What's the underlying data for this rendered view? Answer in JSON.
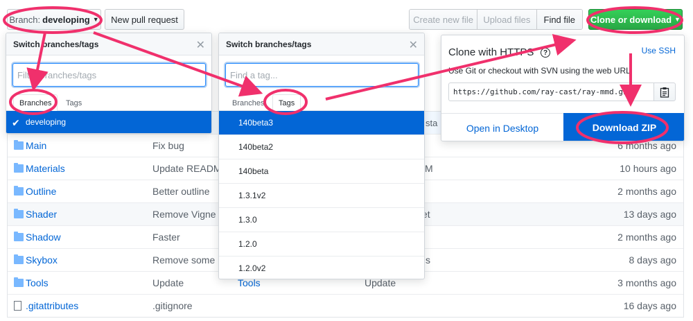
{
  "toolbar": {
    "branch_label": "Branch:",
    "branch_name": "developing",
    "new_pull_request": "New pull request",
    "create_new_file": "Create new file",
    "upload_files": "Upload files",
    "find_file": "Find file",
    "clone_or_download": "Clone or download"
  },
  "files": [
    {
      "name": "Main",
      "message": "Fix bug",
      "age": "6 months ago",
      "type": "folder"
    },
    {
      "name": "Materials",
      "message": "Update READM",
      "age": "10 hours ago",
      "type": "folder"
    },
    {
      "name": "Outline",
      "message": "Better outline",
      "age": "2 months ago",
      "type": "folder"
    },
    {
      "name": "Shader",
      "message": "Remove Vigne",
      "age": "13 days ago",
      "type": "folder"
    },
    {
      "name": "Shadow",
      "message": "Faster",
      "age": "2 months ago",
      "type": "folder"
    },
    {
      "name": "Skybox",
      "message": "Remove some",
      "age": "8 days ago",
      "type": "folder"
    },
    {
      "name": "Tools",
      "message": "Update",
      "age": "3 months ago",
      "type": "folder"
    },
    {
      "name": ".gitattributes",
      "message": ".gitignore",
      "age": "16 days ago",
      "type": "file"
    }
  ],
  "background_fragments": {
    "row_main_msg": "Fix bug",
    "materials_tail": "M",
    "shader_tail": "et",
    "skybox_tail": "s",
    "tools_name": "Tools",
    "tools_msg": "Update",
    "above_row_tail": "sta",
    "main_age": "6 months ago"
  },
  "branch_menu": {
    "title": "Switch branches/tags",
    "filter_placeholder": "Filter branches/tags",
    "tabs": [
      "Branches",
      "Tags"
    ],
    "items": [
      "developing"
    ]
  },
  "tag_menu": {
    "title": "Switch branches/tags",
    "filter_placeholder": "Find a tag...",
    "tabs": [
      "Branches",
      "Tags"
    ],
    "items": [
      "140beta3",
      "140beta2",
      "140beta",
      "1.3.1v2",
      "1.3.0",
      "1.2.0",
      "1.2.0v2"
    ]
  },
  "clone_popup": {
    "title": "Clone with HTTPS",
    "help_glyph": "?",
    "use_ssh": "Use SSH",
    "description": "Use Git or checkout with SVN using the web URL.",
    "url": "https://github.com/ray-cast/ray-mmd.git",
    "open_in_desktop": "Open in Desktop",
    "download_zip": "Download ZIP"
  },
  "colors": {
    "annotation": "#f0306c",
    "link": "#0366d6",
    "green_button": "#28a745",
    "selected_item": "#0366d6"
  }
}
